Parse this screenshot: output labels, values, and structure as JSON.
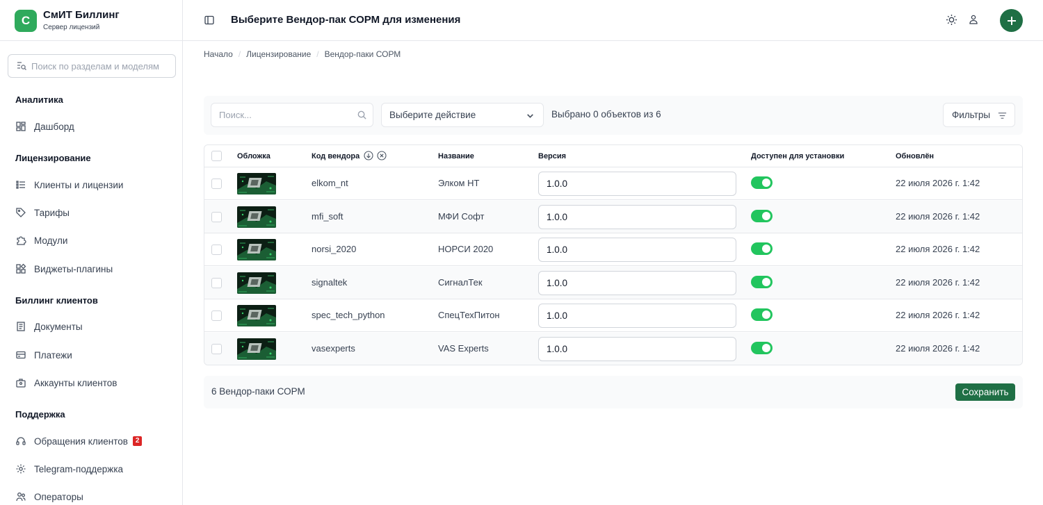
{
  "brand": {
    "logo_letter": "С",
    "title": "СмИТ Биллинг",
    "subtitle": "Сервер лицензий",
    "accent": "#2faa5c"
  },
  "sidebar": {
    "search_placeholder": "Поиск по разделам и моделям",
    "sections": [
      {
        "title": "Аналитика",
        "items": [
          {
            "label": "Дашборд",
            "icon": "dashboard-icon"
          }
        ]
      },
      {
        "title": "Лицензирование",
        "items": [
          {
            "label": "Клиенты и лицензии",
            "icon": "clients-icon"
          },
          {
            "label": "Тарифы",
            "icon": "tag-icon"
          },
          {
            "label": "Модули",
            "icon": "puzzle-icon"
          },
          {
            "label": "Виджеты-плагины",
            "icon": "widget-icon"
          }
        ]
      },
      {
        "title": "Биллинг клиентов",
        "items": [
          {
            "label": "Документы",
            "icon": "document-icon"
          },
          {
            "label": "Платежи",
            "icon": "payment-icon"
          },
          {
            "label": "Аккаунты клиентов",
            "icon": "account-icon"
          }
        ]
      },
      {
        "title": "Поддержка",
        "items": [
          {
            "label": "Обращения клиентов",
            "icon": "support-icon",
            "badge": "2"
          },
          {
            "label": "Telegram-поддержка",
            "icon": "gear-icon"
          },
          {
            "label": "Операторы",
            "icon": "operators-icon"
          }
        ]
      }
    ]
  },
  "header": {
    "title": "Выберите Вендор-пак СОРМ для изменения"
  },
  "breadcrumb": [
    "Начало",
    "Лицензирование",
    "Вендор-паки СОРМ"
  ],
  "toolbar": {
    "search_placeholder": "Поиск...",
    "action_label": "Выберите действие",
    "selected_text": "Выбрано 0 объектов из 6",
    "filters_label": "Фильтры"
  },
  "table": {
    "columns": [
      "Обложка",
      "Код вендора",
      "Название",
      "Версия",
      "Доступен для установки",
      "Обновлён"
    ],
    "rows": [
      {
        "code": "elkom_nt",
        "name": "Элком НТ",
        "version": "1.0.0",
        "available": true,
        "updated": "22 июля 2026 г. 1:42"
      },
      {
        "code": "mfi_soft",
        "name": "МФИ Софт",
        "version": "1.0.0",
        "available": true,
        "updated": "22 июля 2026 г. 1:42"
      },
      {
        "code": "norsi_2020",
        "name": "НОРСИ 2020",
        "version": "1.0.0",
        "available": true,
        "updated": "22 июля 2026 г. 1:42"
      },
      {
        "code": "signaltek",
        "name": "СигналТек",
        "version": "1.0.0",
        "available": true,
        "updated": "22 июля 2026 г. 1:42"
      },
      {
        "code": "spec_tech_python",
        "name": "СпецТехПитон",
        "version": "1.0.0",
        "available": true,
        "updated": "22 июля 2026 г. 1:42"
      },
      {
        "code": "vasexperts",
        "name": "VAS Experts",
        "version": "1.0.0",
        "available": true,
        "updated": "22 июля 2026 г. 1:42"
      }
    ]
  },
  "footer": {
    "count_text": "6 Вендор-паки СОРМ",
    "save_label": "Сохранить"
  },
  "colors": {
    "primary": "#1f6f45",
    "toggle_on": "#22c55e",
    "badge": "#dc2626"
  }
}
